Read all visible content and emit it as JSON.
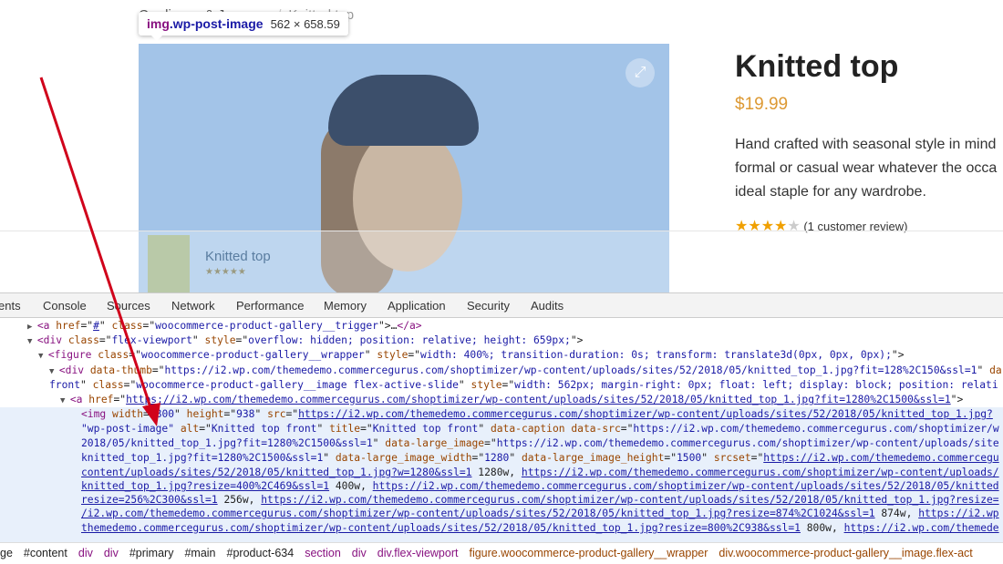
{
  "page": {
    "breadcrumb": {
      "parent": "Cardigans & Jumpers",
      "current": "Knitted top",
      "sep": "/"
    },
    "tooltip": {
      "tag": "img",
      "cls": ".wp-post-image",
      "dims": "562 × 658.59"
    },
    "zoom_icon": "⤢",
    "product": {
      "title": "Knitted top",
      "price": "$19.99",
      "desc": [
        "Hand crafted with seasonal style in mind",
        "formal or casual wear whatever the occa",
        "ideal staple for any wardrobe."
      ],
      "rating": 4,
      "stars_on": "★★★★",
      "stars_off": "★",
      "review_text": "(1 customer review)"
    },
    "sticky": {
      "name": "Knitted top",
      "stars": "★★★★★"
    }
  },
  "devtools": {
    "tabs": [
      "ents",
      "Console",
      "Sources",
      "Network",
      "Performance",
      "Memory",
      "Application",
      "Security",
      "Audits"
    ],
    "lines": [
      {
        "ind": 30,
        "tri": "▶",
        "tok": [
          [
            "t",
            "<a "
          ],
          [
            "a",
            "href"
          ],
          [
            "x",
            "=\""
          ],
          [
            "l",
            "#"
          ],
          [
            "x",
            "\" "
          ],
          [
            "a",
            "class"
          ],
          [
            "x",
            "=\""
          ],
          [
            "v",
            "woocommerce-product-gallery__trigger"
          ],
          [
            "x",
            "\">"
          ],
          [
            "x",
            "…"
          ],
          [
            "t",
            "</a>"
          ]
        ]
      },
      {
        "ind": 30,
        "tri": "▼",
        "tok": [
          [
            "t",
            "<div "
          ],
          [
            "a",
            "class"
          ],
          [
            "x",
            "=\""
          ],
          [
            "v",
            "flex-viewport"
          ],
          [
            "x",
            "\" "
          ],
          [
            "a",
            "style"
          ],
          [
            "x",
            "=\""
          ],
          [
            "v",
            "overflow: hidden; position: relative; height: 659px;"
          ],
          [
            "x",
            "\">"
          ]
        ]
      },
      {
        "ind": 42,
        "tri": "▼",
        "tok": [
          [
            "t",
            "<figure "
          ],
          [
            "a",
            "class"
          ],
          [
            "x",
            "=\""
          ],
          [
            "v",
            "woocommerce-product-gallery__wrapper"
          ],
          [
            "x",
            "\" "
          ],
          [
            "a",
            "style"
          ],
          [
            "x",
            "=\""
          ],
          [
            "v",
            "width: 400%; transition-duration: 0s; transform: translate3d(0px, 0px, 0px);"
          ],
          [
            "x",
            "\">"
          ]
        ]
      },
      {
        "ind": 54,
        "tri": "▼",
        "tok": [
          [
            "t",
            "<div "
          ],
          [
            "a",
            "data-thumb"
          ],
          [
            "x",
            "=\""
          ],
          [
            "v",
            "https://i2.wp.com/themedemo.commercegurus.com/shoptimizer/wp-content/uploads/sites/52/2018/05/knitted_top_1.jpg?fit=128%2C150&ssl=1"
          ],
          [
            "x",
            "\" "
          ],
          [
            "a",
            "da"
          ]
        ]
      },
      {
        "ind": 54,
        "tri": "",
        "tok": [
          [
            "v",
            "front"
          ],
          [
            "x",
            "\" "
          ],
          [
            "a",
            "class"
          ],
          [
            "x",
            "=\""
          ],
          [
            "v",
            "woocommerce-product-gallery__image flex-active-slide"
          ],
          [
            "x",
            "\" "
          ],
          [
            "a",
            "style"
          ],
          [
            "x",
            "=\""
          ],
          [
            "v",
            "width: 562px; margin-right: 0px; float: left; display: block; position: relati"
          ]
        ]
      },
      {
        "ind": 66,
        "tri": "▼",
        "tok": [
          [
            "t",
            "<a "
          ],
          [
            "a",
            "href"
          ],
          [
            "x",
            "=\""
          ],
          [
            "l",
            "https://i2.wp.com/themedemo.commercegurus.com/shoptimizer/wp-content/uploads/sites/52/2018/05/knitted_top_1.jpg?fit=1280%2C1500&ssl=1"
          ],
          [
            "x",
            "\">"
          ]
        ]
      },
      {
        "ind": 89,
        "tri": "",
        "tok": [
          [
            "t",
            "<img "
          ],
          [
            "a",
            "width"
          ],
          [
            "x",
            "=\""
          ],
          [
            "v",
            "800"
          ],
          [
            "x",
            "\" "
          ],
          [
            "a",
            "height"
          ],
          [
            "x",
            "=\""
          ],
          [
            "v",
            "938"
          ],
          [
            "x",
            "\" "
          ],
          [
            "a",
            "src"
          ],
          [
            "x",
            "=\""
          ],
          [
            "l",
            "https://i2.wp.com/themedemo.commercegurus.com/shoptimizer/wp-content/uploads/sites/52/2018/05/knitted_top_1.jpg?"
          ]
        ]
      },
      {
        "ind": 89,
        "tri": "",
        "tok": [
          [
            "v",
            "\"wp-post-image\" "
          ],
          [
            "a",
            "alt"
          ],
          [
            "x",
            "=\""
          ],
          [
            "v",
            "Knitted top front"
          ],
          [
            "x",
            "\" "
          ],
          [
            "a",
            "title"
          ],
          [
            "x",
            "=\""
          ],
          [
            "v",
            "Knitted top front"
          ],
          [
            "x",
            "\" "
          ],
          [
            "a",
            "data-caption data-src"
          ],
          [
            "x",
            "=\""
          ],
          [
            "v",
            "https://i2.wp.com/themedemo.commercegurus.com/shoptimizer/w"
          ]
        ]
      },
      {
        "ind": 89,
        "tri": "",
        "tok": [
          [
            "v",
            "2018/05/knitted_top_1.jpg?fit=1280%2C1500&ssl=1"
          ],
          [
            "x",
            "\" "
          ],
          [
            "a",
            "data-large_image"
          ],
          [
            "x",
            "=\""
          ],
          [
            "v",
            "https://i2.wp.com/themedemo.commercegurus.com/shoptimizer/wp-content/uploads/site"
          ]
        ]
      },
      {
        "ind": 89,
        "tri": "",
        "tok": [
          [
            "v",
            "knitted_top_1.jpg?fit=1280%2C1500&ssl=1"
          ],
          [
            "x",
            "\" "
          ],
          [
            "a",
            "data-large_image_width"
          ],
          [
            "x",
            "=\""
          ],
          [
            "v",
            "1280"
          ],
          [
            "x",
            "\" "
          ],
          [
            "a",
            "data-large_image_height"
          ],
          [
            "x",
            "=\""
          ],
          [
            "v",
            "1500"
          ],
          [
            "x",
            "\" "
          ],
          [
            "a",
            "srcset"
          ],
          [
            "x",
            "=\""
          ],
          [
            "l",
            "https://i2.wp.com/themedemo.commercegu"
          ]
        ]
      },
      {
        "ind": 89,
        "tri": "",
        "tok": [
          [
            "l",
            "content/uploads/sites/52/2018/05/knitted_top_1.jpg?w=1280&ssl=1"
          ],
          [
            "x",
            " 1280w, "
          ],
          [
            "l",
            "https://i2.wp.com/themedemo.commercegurus.com/shoptimizer/wp-content/uploads/"
          ]
        ]
      },
      {
        "ind": 89,
        "tri": "",
        "tok": [
          [
            "l",
            "knitted_top_1.jpg?resize=400%2C469&ssl=1"
          ],
          [
            "x",
            " 400w, "
          ],
          [
            "l",
            "https://i2.wp.com/themedemo.commercegurus.com/shoptimizer/wp-content/uploads/sites/52/2018/05/knitted"
          ]
        ]
      },
      {
        "ind": 89,
        "tri": "",
        "tok": [
          [
            "l",
            "resize=256%2C300&ssl=1"
          ],
          [
            "x",
            " 256w, "
          ],
          [
            "l",
            "https://i2.wp.com/themedemo.commercegurus.com/shoptimizer/wp-content/uploads/sites/52/2018/05/knitted_top_1.jpg?resize="
          ]
        ]
      },
      {
        "ind": 89,
        "tri": "",
        "tok": [
          [
            "l",
            "/i2.wp.com/themedemo.commercegurus.com/shoptimizer/wp-content/uploads/sites/52/2018/05/knitted_top_1.jpg?resize=874%2C1024&ssl=1"
          ],
          [
            "x",
            " 874w, "
          ],
          [
            "l",
            "https://i2.wp"
          ]
        ]
      },
      {
        "ind": 89,
        "tri": "",
        "tok": [
          [
            "l",
            "themedemo.commercegurus.com/shoptimizer/wp-content/uploads/sites/52/2018/05/knitted_top_1.jpg?resize=800%2C938&ssl=1"
          ],
          [
            "x",
            " 800w, "
          ],
          [
            "l",
            "https://i2.wp.com/themede"
          ]
        ]
      }
    ],
    "breadcrumbs": [
      [
        "id",
        "ge"
      ],
      [
        "id",
        "#content"
      ],
      [
        "tg",
        "div"
      ],
      [
        "tg",
        "div"
      ],
      [
        "id",
        "#primary"
      ],
      [
        "id",
        "#main"
      ],
      [
        "id",
        "#product-634"
      ],
      [
        "tg",
        "section"
      ],
      [
        "tg",
        "div"
      ],
      [
        "tg",
        "div.flex-viewport"
      ],
      [
        "cl",
        "figure.woocommerce-product-gallery__wrapper"
      ],
      [
        "cl",
        "div.woocommerce-product-gallery__image.flex-act"
      ]
    ]
  },
  "colors": {
    "highlight": "#a3c4e8",
    "tag": "#881280",
    "attr": "#994500",
    "value": "#1a1aa6",
    "arrow": "#d0021b",
    "price": "#dd9933"
  }
}
